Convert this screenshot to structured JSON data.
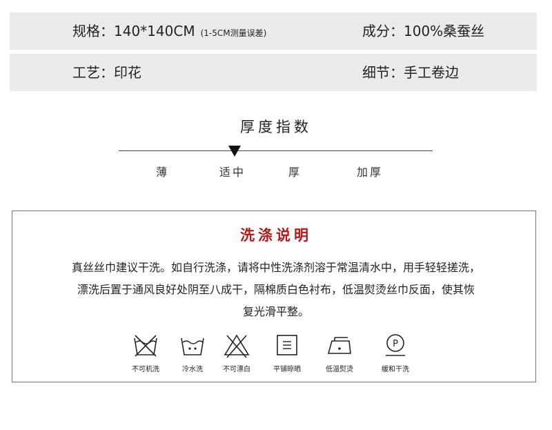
{
  "specs": [
    {
      "left": {
        "label": "规格：",
        "value": "140*140CM",
        "note": "(1-5CM测量误差)"
      },
      "right": {
        "label": "成分：",
        "value": "100%桑蚕丝"
      }
    },
    {
      "left": {
        "label": "工艺：",
        "value": "印花"
      },
      "right": {
        "label": "细节：",
        "value": "手工卷边"
      }
    }
  ],
  "thickness": {
    "title": "厚度指数",
    "levels": [
      "薄",
      "适中",
      "厚",
      "加厚"
    ],
    "selected": "适中"
  },
  "wash": {
    "title": "洗涤说明",
    "lines": [
      "真丝丝巾建议干洗。如自行洗涤，请将中性洗涤剂溶于常温清水中，用手轻轻搓洗，",
      "漂洗后置于通风良好处阴至八成干，隔棉质白色衬布，低温熨烫丝巾反面，使其恢",
      "复光滑平整。"
    ],
    "care": [
      {
        "icon": "no-machine-wash-icon",
        "label": "不可机洗"
      },
      {
        "icon": "cold-wash-icon",
        "label": "冷水洗"
      },
      {
        "icon": "no-bleach-icon",
        "label": "不可漂白"
      },
      {
        "icon": "flat-dry-icon",
        "label": "平铺晾晒"
      },
      {
        "icon": "low-iron-icon",
        "label": "低温熨烫"
      },
      {
        "icon": "gentle-dry-clean-icon",
        "label": "缓和干洗"
      }
    ]
  },
  "colors": {
    "accent": "#b01a1a",
    "row_bg": "#ebebeb"
  }
}
